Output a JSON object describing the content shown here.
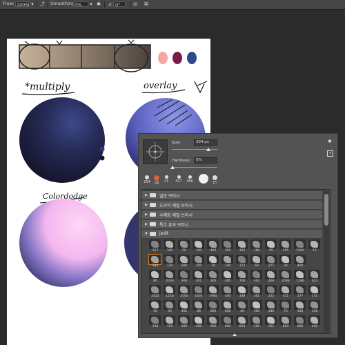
{
  "options_bar": {
    "flow_label": "Flow:",
    "flow_value": "100%",
    "smoothing_label": "Smoothing:",
    "smoothing_value": "0%",
    "angle_value": "0°"
  },
  "canvas": {
    "labels": {
      "multiply": "*multiply",
      "overlay": "overlay",
      "colordodge": "Colordodge"
    },
    "swatch_colors": [
      "#f4a6a4",
      "#7a1a48",
      "#2a4a8c"
    ],
    "bar_colors": [
      "#c8b49a",
      "#a89680",
      "#8a7a6a",
      "#6a5e52",
      "#4e4540"
    ]
  },
  "brush_panel": {
    "size_label": "Size:",
    "size_value": "394 px",
    "hardness_label": "Hardness:",
    "hardness_value": "0%",
    "recent_brushes": [
      "254",
      "28",
      "21",
      "417",
      "466",
      "15"
    ],
    "groups": [
      {
        "name": "일반 브러시",
        "expanded": false
      },
      {
        "name": "드라이 재질 브러시",
        "expanded": false
      },
      {
        "name": "수채화 재질 브러시",
        "expanded": false
      },
      {
        "name": "특수 효과 브러시",
        "expanded": false
      },
      {
        "name": "jedit",
        "expanded": true
      }
    ],
    "brush_rows": [
      [
        "117",
        "100",
        "50",
        "100",
        "400",
        "200",
        "292",
        "189",
        "95",
        "205",
        "1000",
        "15"
      ],
      [
        "380",
        "120",
        "200",
        "200",
        "70",
        "140",
        "172",
        "60",
        "277",
        "24",
        "400"
      ],
      [
        "80",
        "2000",
        "306",
        "401",
        "300",
        "400",
        "700",
        "402",
        "428",
        "2098",
        "1186",
        "623"
      ],
      [
        "2422",
        "1218",
        "2500",
        "1601",
        "1985",
        "400",
        "339",
        "301",
        "225",
        "411",
        "177",
        "175"
      ],
      [
        "30",
        "30",
        "462",
        "48",
        "600",
        "600",
        "40",
        "300",
        "340",
        "75",
        "100",
        "138"
      ],
      [
        "138",
        "150",
        "100",
        "400",
        "500",
        "600",
        "604",
        "200",
        "251",
        "604",
        "600",
        "400"
      ]
    ],
    "selected_brush": "120"
  }
}
